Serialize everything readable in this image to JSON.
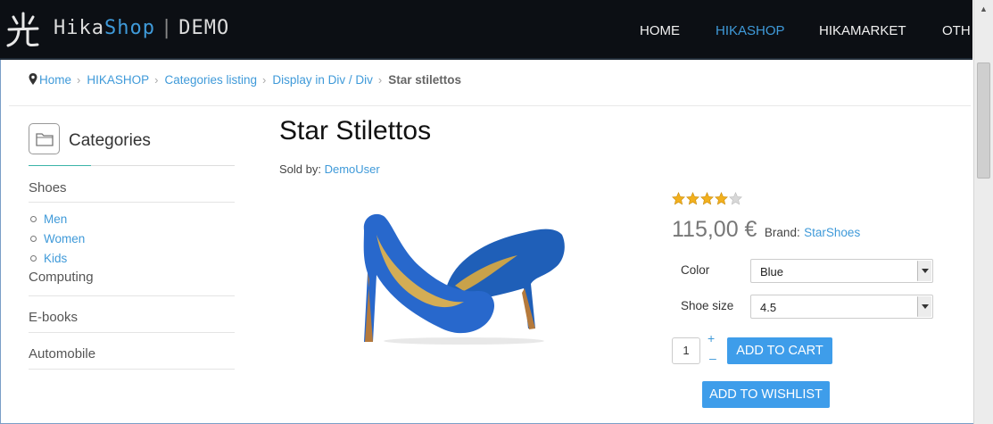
{
  "header": {
    "brand_hika": "Hika",
    "brand_shop": "Shop",
    "brand_sep": "|",
    "brand_demo": "DEMO",
    "nav": [
      "HOME",
      "HIKASHOP",
      "HIKAMARKET",
      "OTH"
    ],
    "active_nav": "HIKASHOP"
  },
  "breadcrumb": {
    "items": [
      "Home",
      "HIKASHOP",
      "Categories listing",
      "Display in Div / Div"
    ],
    "current": "Star stilettos"
  },
  "sidebar": {
    "title": "Categories",
    "categories": [
      "Shoes",
      "Computing",
      "E-books",
      "Automobile"
    ],
    "subcategories": [
      "Men",
      "Women",
      "Kids"
    ]
  },
  "product": {
    "title": "Star Stilettos",
    "sold_by_label": "Sold by:",
    "vendor": "DemoUser",
    "rating_stars": 4,
    "rating_max": 5,
    "price": "115,00 €",
    "brand_label": "Brand:",
    "brand": "StarShoes",
    "options": {
      "color_label": "Color",
      "color_value": "Blue",
      "size_label": "Shoe size",
      "size_value": "4.5"
    },
    "quantity": "1",
    "qty_plus": "+",
    "qty_minus": "–",
    "add_to_cart": "ADD TO CART",
    "add_to_wishlist": "ADD TO WISHLIST"
  },
  "colors": {
    "accent": "#3f9ad9",
    "button": "#3e9dea",
    "topbar": "#0c0f14",
    "star": "#f2b01e"
  },
  "icons": [
    "logo-glyph",
    "map-pin-icon",
    "chevron-right-icon",
    "folder-icon",
    "star-icon",
    "dropdown-arrow-icon",
    "shoe-product-image"
  ]
}
